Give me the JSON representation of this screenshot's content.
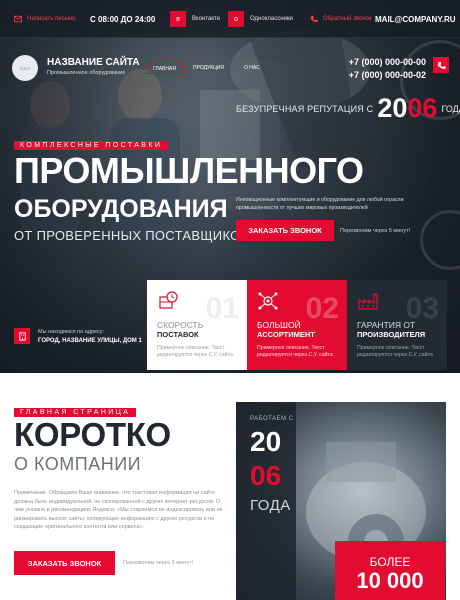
{
  "colors": {
    "accent": "#e30c30",
    "dark": "#232a33",
    "heading": "#222831"
  },
  "topbar": {
    "link1": "Написать письмо",
    "hours": "С 08:00 ДО 24:00",
    "social1": "Вконтакте",
    "social2": "Одноклассники",
    "link2": "Обратный звонок",
    "email": "MAIL@COMPANY.RU"
  },
  "header": {
    "logo_text": "ЛОГО",
    "site_title": "НАЗВАНИЕ САЙТА",
    "site_subtitle": "Промышленное оборудование",
    "nav": [
      "ГЛАВНАЯ",
      "ПРОДУКЦИЯ",
      "О НАС"
    ],
    "phones": [
      "+7 (000) 000-00-00",
      "+7 (000) 000-00-02"
    ]
  },
  "hero": {
    "reputation_before": "БЕЗУПРЕЧНАЯ РЕПУТАЦИЯ С",
    "year_part1": "20",
    "year_part2": "06",
    "reputation_after": "ГОДА",
    "tag": "КОМПЛЕКСНЫЕ ПОСТАВКИ",
    "title_line1": "ПРОМЫШЛЕННОГО",
    "title_line2": "ОБОРУДОВАНИЯ",
    "title_line3": "ОТ ПРОВЕРЕННЫХ ПОСТАВЩИКОВ",
    "description": "Инновационные комплектующие и оборудование для любой отрасли промышленности от лучших мировых производителей",
    "cta_label": "ЗАКАЗАТЬ ЗВОНОК",
    "cta_note": "Перезвоним через 5 минут!"
  },
  "address": {
    "label": "Мы находимся по адресу:",
    "value": "ГОРОД, НАЗВАНИЕ УЛИЦЫ, ДОМ 1"
  },
  "features": [
    {
      "num": "01",
      "title_light": "СКОРОСТЬ",
      "title_bold": "ПОСТАВОК",
      "desc": "Примерное описание. Текст редактируется через С.У. сайта",
      "icon": "clock-box-icon"
    },
    {
      "num": "02",
      "title_light": "БОЛЬШОЙ",
      "title_bold": "АССОРТИМЕНТ",
      "desc": "Примерное описание. Текст редактируется через С.У. сайта",
      "icon": "network-gear-icon"
    },
    {
      "num": "03",
      "title_light": "ГАРАНТИЯ ОТ",
      "title_bold": "ПРОИЗВОДИТЕЛЯ",
      "desc": "Примерное описание. Текст редактируется через С.У. сайта",
      "icon": "factory-icon"
    }
  ],
  "about": {
    "tag": "ГЛАВНАЯ СТРАНИЦА",
    "title": "КОРОТКО",
    "subtitle": "О КОМПАНИИ",
    "text": "Примечание. Обращаем Ваше внимание, что текстовая информация на сайте должна быть индивидуальной, не скопированной с других интернет-ресурсов. О чем указано в рекомендациях Яндекса: «Мы стараемся не индексировать или не ранжировать высоко сайты, копирующие информацию с других ресурсов и не создающие оригинального контента или сервиса».",
    "cta_label": "ЗАКАЗАТЬ ЗВОНОК",
    "cta_note": "Перезвоним через 5 минут!"
  },
  "side_panel": {
    "since_label": "РАБОТАЕМ С",
    "year_part1": "20",
    "year_part2": "06",
    "year_word": "ГОДА",
    "stat_label": "БОЛЕЕ",
    "stat_value": "10 000"
  }
}
